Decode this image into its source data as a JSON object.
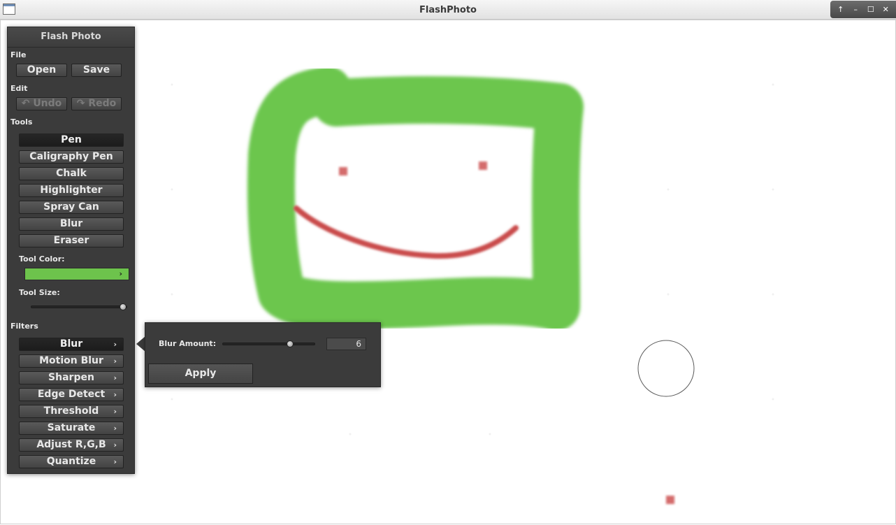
{
  "window": {
    "title": "FlashPhoto",
    "controls": [
      "↑",
      "–",
      "☐",
      "✕"
    ]
  },
  "panel": {
    "title": "Flash Photo",
    "file": {
      "label": "File",
      "open": "Open",
      "save": "Save"
    },
    "edit": {
      "label": "Edit",
      "undo": "Undo",
      "redo": "Redo",
      "undo_icon": "undo-arrow-icon",
      "redo_icon": "redo-arrow-icon"
    },
    "tools": {
      "label": "Tools",
      "items": [
        "Pen",
        "Caligraphy Pen",
        "Chalk",
        "Highlighter",
        "Spray Can",
        "Blur",
        "Eraser"
      ],
      "selected": "Pen"
    },
    "tool_color": {
      "label": "Tool Color:",
      "value": "#6dc34c"
    },
    "tool_size": {
      "label": "Tool Size:",
      "value": 1.0
    },
    "filters": {
      "label": "Filters",
      "items": [
        "Blur",
        "Motion Blur",
        "Sharpen",
        "Edge Detect",
        "Threshold",
        "Saturate",
        "Adjust R,G,B",
        "Quantize"
      ],
      "selected": "Blur"
    }
  },
  "blur_popup": {
    "label": "Blur Amount:",
    "value": "6",
    "slider_fraction": 0.73,
    "apply": "Apply"
  },
  "colors": {
    "stroke_green": "#6cc64d",
    "stroke_red": "#c94c4c",
    "panel_bg": "#3b3b3b"
  }
}
